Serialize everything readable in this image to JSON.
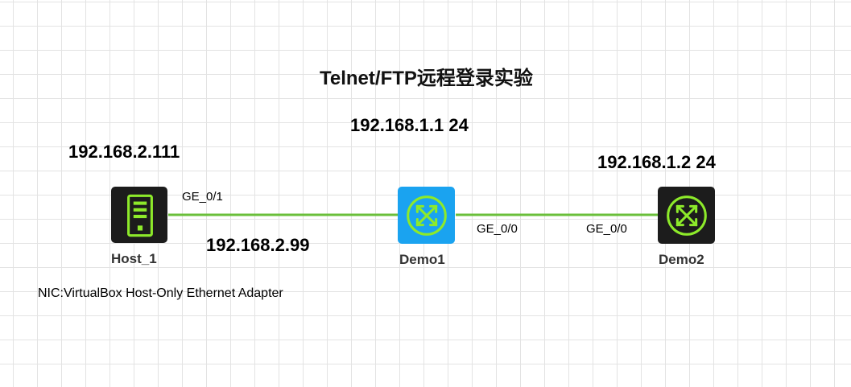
{
  "title": "Telnet/FTP远程登录实验",
  "colors": {
    "link": "#6abf3a",
    "accent_green": "#8dea2a",
    "demo1_bg": "#1aa3f0",
    "dark_bg": "#1c1c1c"
  },
  "devices": {
    "host": {
      "label": "Host_1",
      "icon": "server-icon",
      "ip": "192.168.2.111",
      "note": "NIC:VirtualBox Host-Only Ethernet Adapter"
    },
    "demo1": {
      "label": "Demo1",
      "icon": "switch-icon",
      "ip": "192.168.1.1 24"
    },
    "demo2": {
      "label": "Demo2",
      "icon": "router-icon",
      "ip": "192.168.1.2 24"
    }
  },
  "links": [
    {
      "from": "Host_1",
      "to": "Demo1",
      "from_port": "GE_0/1",
      "ip": "192.168.2.99"
    },
    {
      "from": "Demo1",
      "to": "Demo2",
      "from_port": "GE_0/0",
      "to_port": "GE_0/0"
    }
  ]
}
